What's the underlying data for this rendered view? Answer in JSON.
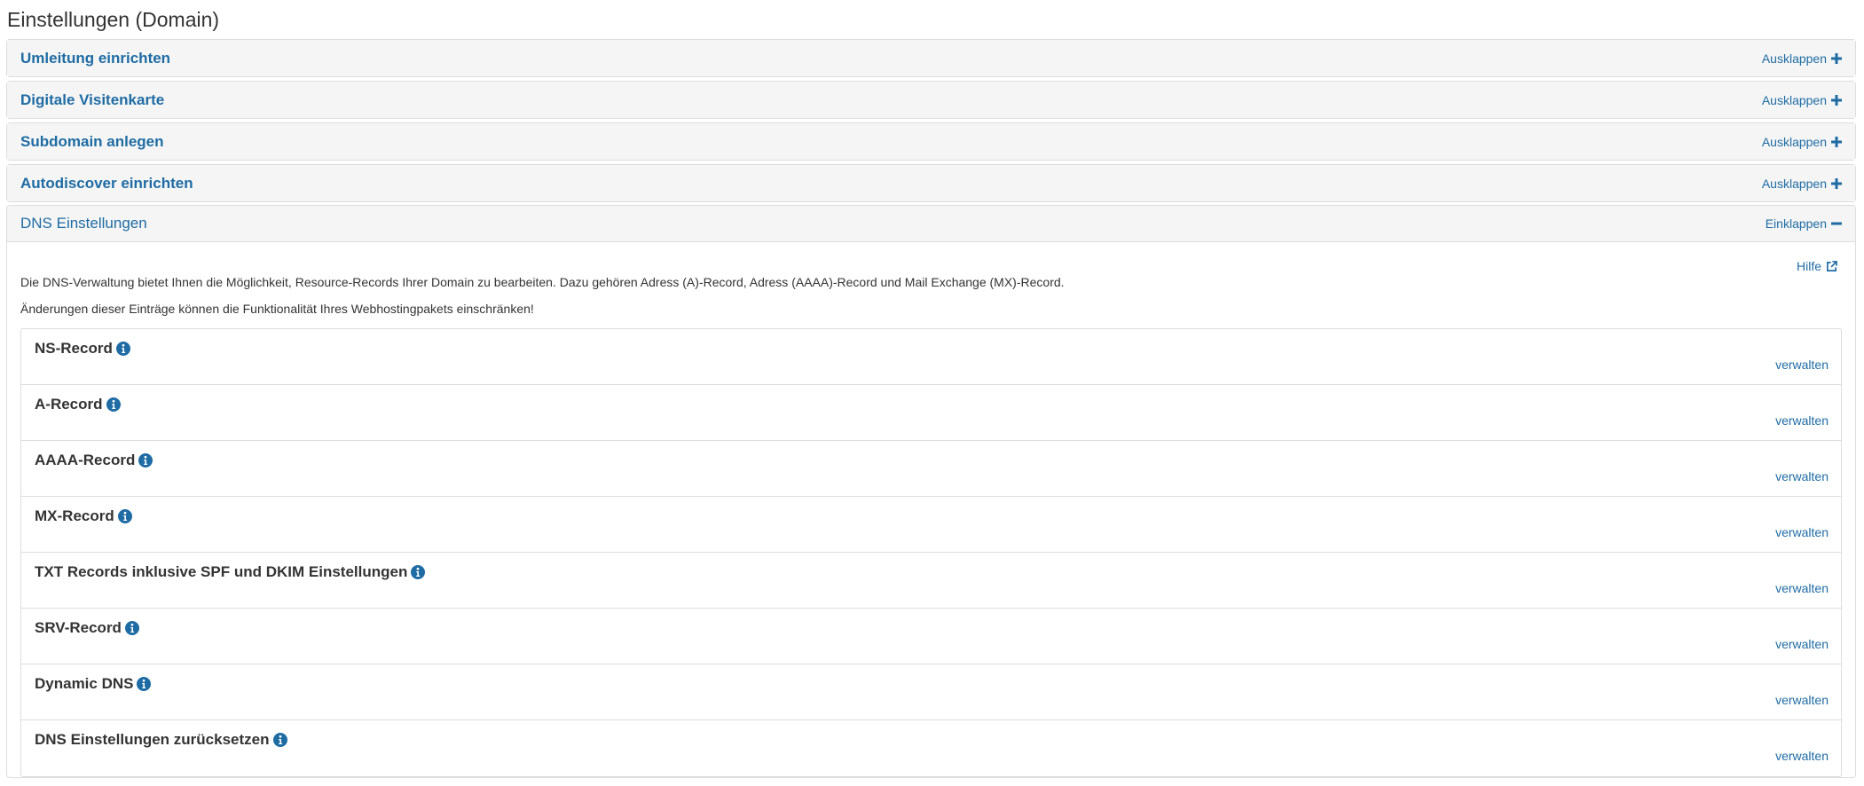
{
  "page": {
    "title": "Einstellungen (Domain)"
  },
  "panels": [
    {
      "title": "Umleitung einrichten",
      "toggle": "Ausklappen"
    },
    {
      "title": "Digitale Visitenkarte",
      "toggle": "Ausklappen"
    },
    {
      "title": "Subdomain anlegen",
      "toggle": "Ausklappen"
    },
    {
      "title": "Autodiscover einrichten",
      "toggle": "Ausklappen"
    }
  ],
  "dns": {
    "title": "DNS Einstellungen",
    "toggle": "Einklappen",
    "help": "Hilfe",
    "description_1": "Die DNS-Verwaltung bietet Ihnen die Möglichkeit, Resource-Records Ihrer Domain zu bearbeiten. Dazu gehören Adress (A)-Record, Adress (AAAA)-Record und Mail Exchange (MX)-Record.",
    "description_2": "Änderungen dieser Einträge können die Funktionalität Ihres Webhostingpakets einschränken!",
    "records": [
      {
        "title": "NS-Record",
        "action": "verwalten"
      },
      {
        "title": "A-Record",
        "action": "verwalten"
      },
      {
        "title": "AAAA-Record",
        "action": "verwalten"
      },
      {
        "title": "MX-Record",
        "action": "verwalten"
      },
      {
        "title": "TXT Records inklusive SPF und DKIM Einstellungen",
        "action": "verwalten"
      },
      {
        "title": "SRV-Record",
        "action": "verwalten"
      },
      {
        "title": "Dynamic DNS",
        "action": "verwalten"
      },
      {
        "title": "DNS Einstellungen zurücksetzen",
        "action": "verwalten"
      }
    ]
  },
  "colors": {
    "link": "#1f6ca4",
    "heading_bg": "#f5f5f5",
    "border": "#dddddd",
    "text": "#333333"
  },
  "icons": {
    "expand": "plus-icon",
    "collapse": "minus-icon",
    "help": "external-link-icon",
    "info": "info-circle-icon"
  }
}
